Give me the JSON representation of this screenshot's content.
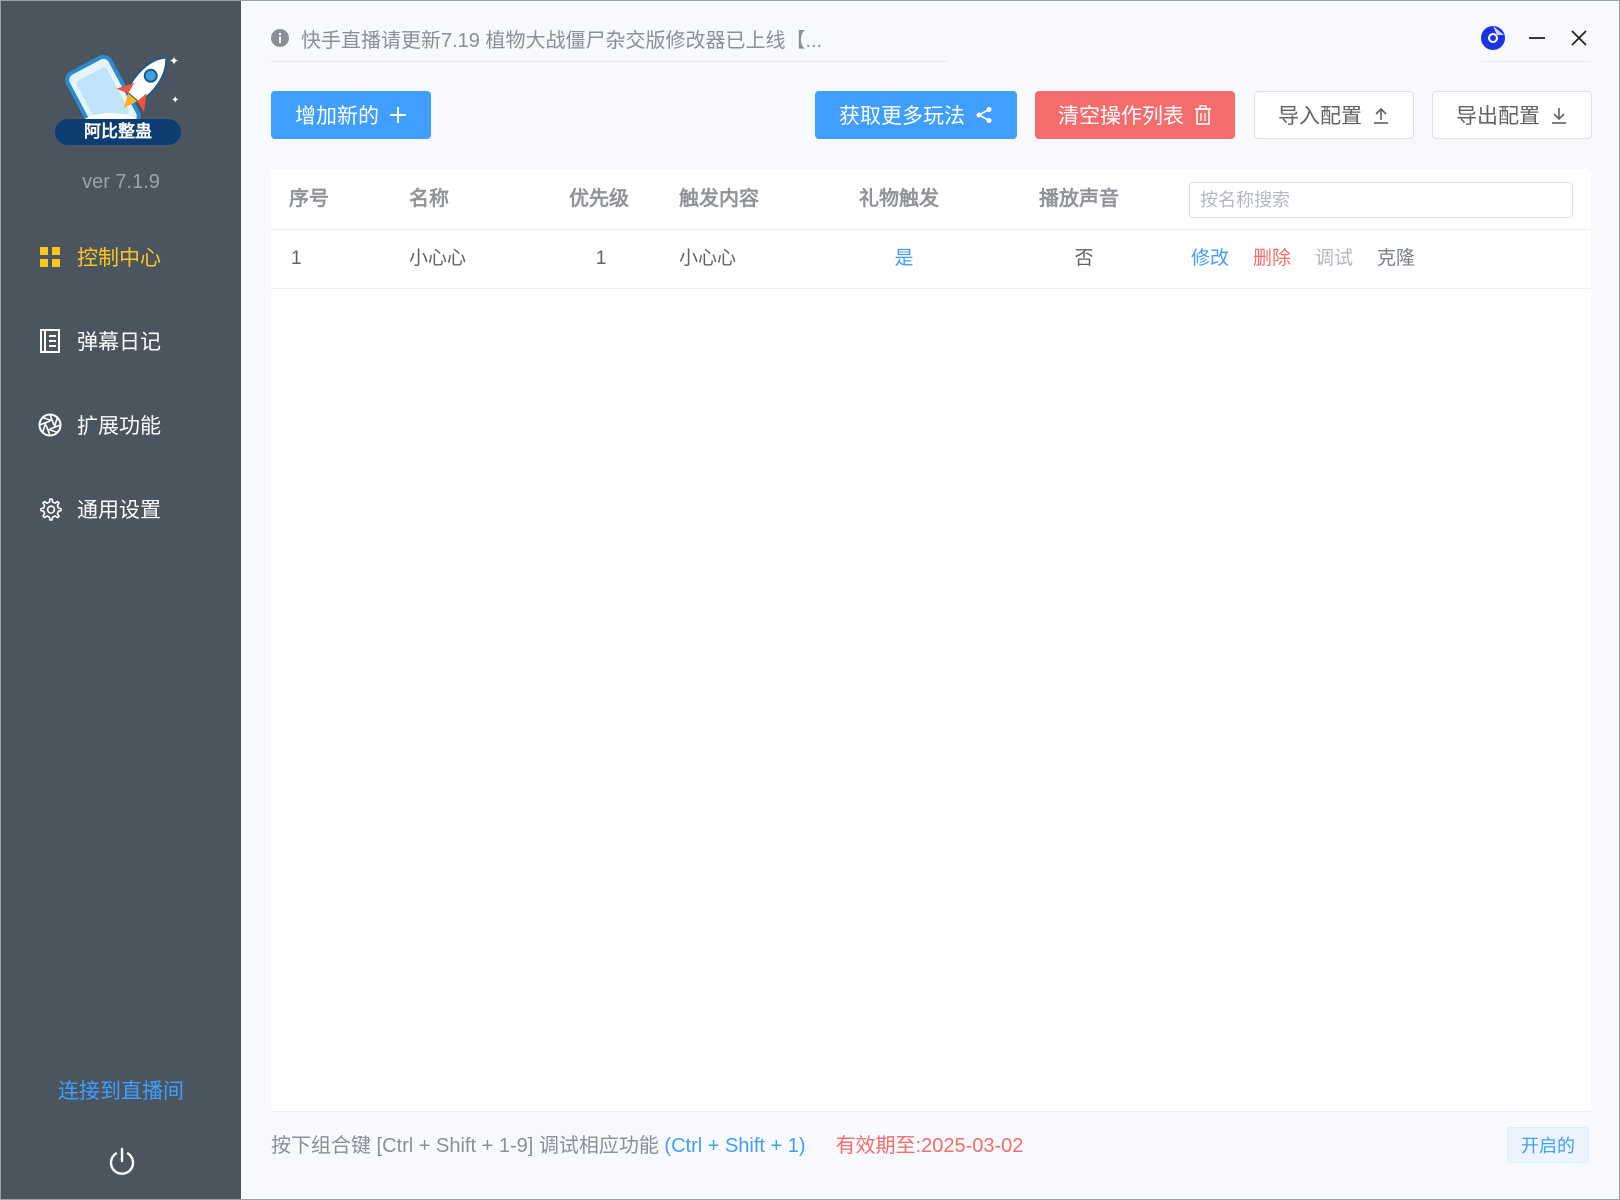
{
  "app": {
    "logo_text": "阿比整蛊",
    "version": "ver 7.1.9"
  },
  "sidebar": {
    "items": [
      {
        "label": "控制中心",
        "icon": "grid-icon",
        "active": true
      },
      {
        "label": "弹幕日记",
        "icon": "notebook-icon",
        "active": false
      },
      {
        "label": "扩展功能",
        "icon": "aperture-icon",
        "active": false
      },
      {
        "label": "通用设置",
        "icon": "gear-icon",
        "active": false
      }
    ],
    "connect_label": "连接到直播间",
    "power_icon": "power-icon"
  },
  "titlebar": {
    "notice": "快手直播请更新7.19 植物大战僵尸杂交版修改器已上线【...",
    "controls": [
      "browser-icon",
      "minimize-icon",
      "close-icon"
    ]
  },
  "toolbar": {
    "add_label": "增加新的",
    "more_label": "获取更多玩法",
    "clear_label": "清空操作列表",
    "import_label": "导入配置",
    "export_label": "导出配置"
  },
  "table": {
    "columns": [
      "序号",
      "名称",
      "优先级",
      "触发内容",
      "礼物触发",
      "播放声音"
    ],
    "search_placeholder": "按名称搜索",
    "rows": [
      {
        "index": "1",
        "name": "小心心",
        "priority": "1",
        "trigger": "小心心",
        "gift_trigger": "是",
        "play_sound": "否",
        "actions": [
          "修改",
          "删除",
          "调试",
          "克隆"
        ]
      }
    ]
  },
  "footer": {
    "hint": "按下组合键 [Ctrl + Shift + 1-9] 调试相应功能 ",
    "hint_shortcut": "(Ctrl + Shift + 1)",
    "expiry": "有效期至:2025-03-02",
    "status": "开启的"
  },
  "colors": {
    "sidebar_bg": "#4a5560",
    "active_nav": "#ffc61a",
    "primary": "#409eff",
    "danger": "#f56c6c",
    "muted": "#b4b8bf"
  }
}
